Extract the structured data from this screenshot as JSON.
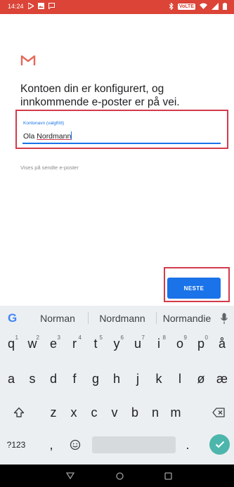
{
  "status_bar": {
    "time": "14:24",
    "left_icons": [
      "play-icon",
      "image-icon",
      "chat-icon"
    ],
    "right_icons": [
      "bluetooth-icon",
      "volte-icon",
      "wifi-icon",
      "signal-icon",
      "battery-icon"
    ],
    "badge": "VoLTE",
    "color": "#db4437"
  },
  "app": {
    "logo": "gmail-icon",
    "headline_line1": "Kontoen din er konfigurert, og",
    "headline_line2": "innkommende e-poster er på vei."
  },
  "account_field": {
    "label": "Kontonavn (valgfritt)",
    "value_first": "Ola",
    "value_second": "Nordmann"
  },
  "helper_text": "Vises på sendte e-poster",
  "next_button": {
    "label": "NESTE",
    "color": "#1a73e8"
  },
  "keyboard": {
    "suggestions": [
      "Norman",
      "Nordmann",
      "Normandie"
    ],
    "row1": [
      {
        "k": "q",
        "n": "1"
      },
      {
        "k": "w",
        "n": "2"
      },
      {
        "k": "e",
        "n": "3"
      },
      {
        "k": "r",
        "n": "4"
      },
      {
        "k": "t",
        "n": "5"
      },
      {
        "k": "y",
        "n": "6"
      },
      {
        "k": "u",
        "n": "7"
      },
      {
        "k": "i",
        "n": "8"
      },
      {
        "k": "o",
        "n": "9"
      },
      {
        "k": "p",
        "n": "0"
      },
      {
        "k": "å",
        "n": ""
      }
    ],
    "row2": [
      "a",
      "s",
      "d",
      "f",
      "g",
      "h",
      "j",
      "k",
      "l",
      "ø",
      "æ"
    ],
    "row3": [
      "z",
      "x",
      "c",
      "v",
      "b",
      "n",
      "m"
    ],
    "symbols_key": "?123",
    "comma_key": ",",
    "period_key": "."
  },
  "nav_bar": {
    "buttons": [
      "back-icon",
      "home-icon",
      "recents-icon"
    ]
  },
  "colors": {
    "accent": "#1a73e8",
    "highlight": "#d33b4b",
    "enter": "#4db6ac"
  }
}
